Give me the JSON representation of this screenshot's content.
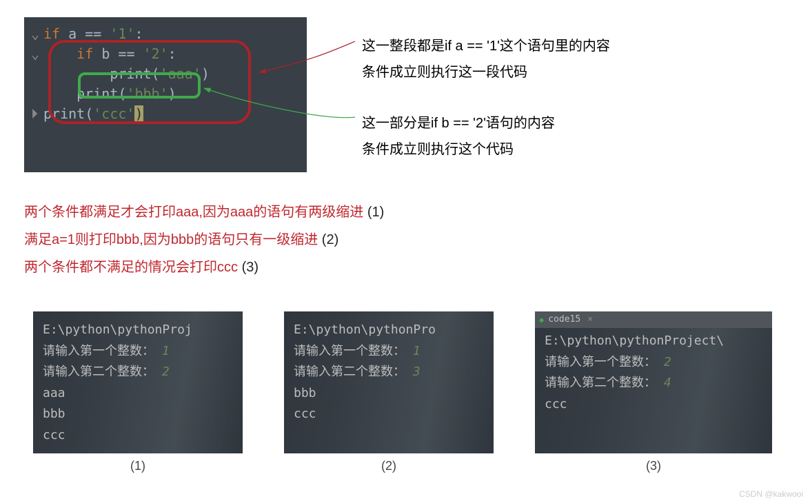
{
  "code_top": {
    "line1_kw": "if",
    "line1_var": "a",
    "line1_op": "==",
    "line1_str": "'1'",
    "line1_colon": ":",
    "line2_kw": "if",
    "line2_var": "b",
    "line2_op": "==",
    "line2_str": "'2'",
    "line2_colon": ":",
    "line3_fn": "print",
    "line3_arg": "'aaa'",
    "line4_fn": "print",
    "line4_arg": "'bbb'",
    "line5_fn": "print",
    "line5_arg": "'ccc'"
  },
  "annotations": {
    "red": {
      "l1": "这一整段都是if a == '1'这个语句里的内容",
      "l2": "条件成立则执行这一段代码"
    },
    "green": {
      "l1": "这一部分是if b == '2'语句的内容",
      "l2": "条件成立则执行这个代码"
    }
  },
  "red_notes": {
    "n1": "两个条件都满足才会打印aaa,因为aaa的语句有两级缩进",
    "n1_num": "(1)",
    "n2": "满足a=1则打印bbb,因为bbb的语句只有一级缩进",
    "n2_num": "(2)",
    "n3": "两个条件都不满足的情况会打印ccc",
    "n3_num": "(3)"
  },
  "consoles": {
    "path1": "E:\\python\\pythonProj",
    "path2": "E:\\python\\pythonPro",
    "path3": "E:\\python\\pythonProject\\",
    "prompt1": "请输入第一个整数：",
    "prompt2": "请输入第二个整数：",
    "c1_i1": "1",
    "c1_i2": "2",
    "c1_out": [
      "aaa",
      "bbb",
      "ccc"
    ],
    "c2_i1": "1",
    "c2_i2": "3",
    "c2_out": [
      "bbb",
      "ccc"
    ],
    "c3_i1": "2",
    "c3_i2": "4",
    "c3_out": [
      "ccc"
    ],
    "tab3": "code15",
    "cap1": "(1)",
    "cap2": "(2)",
    "cap3": "(3)"
  },
  "watermark": "CSDN @kakwooi"
}
